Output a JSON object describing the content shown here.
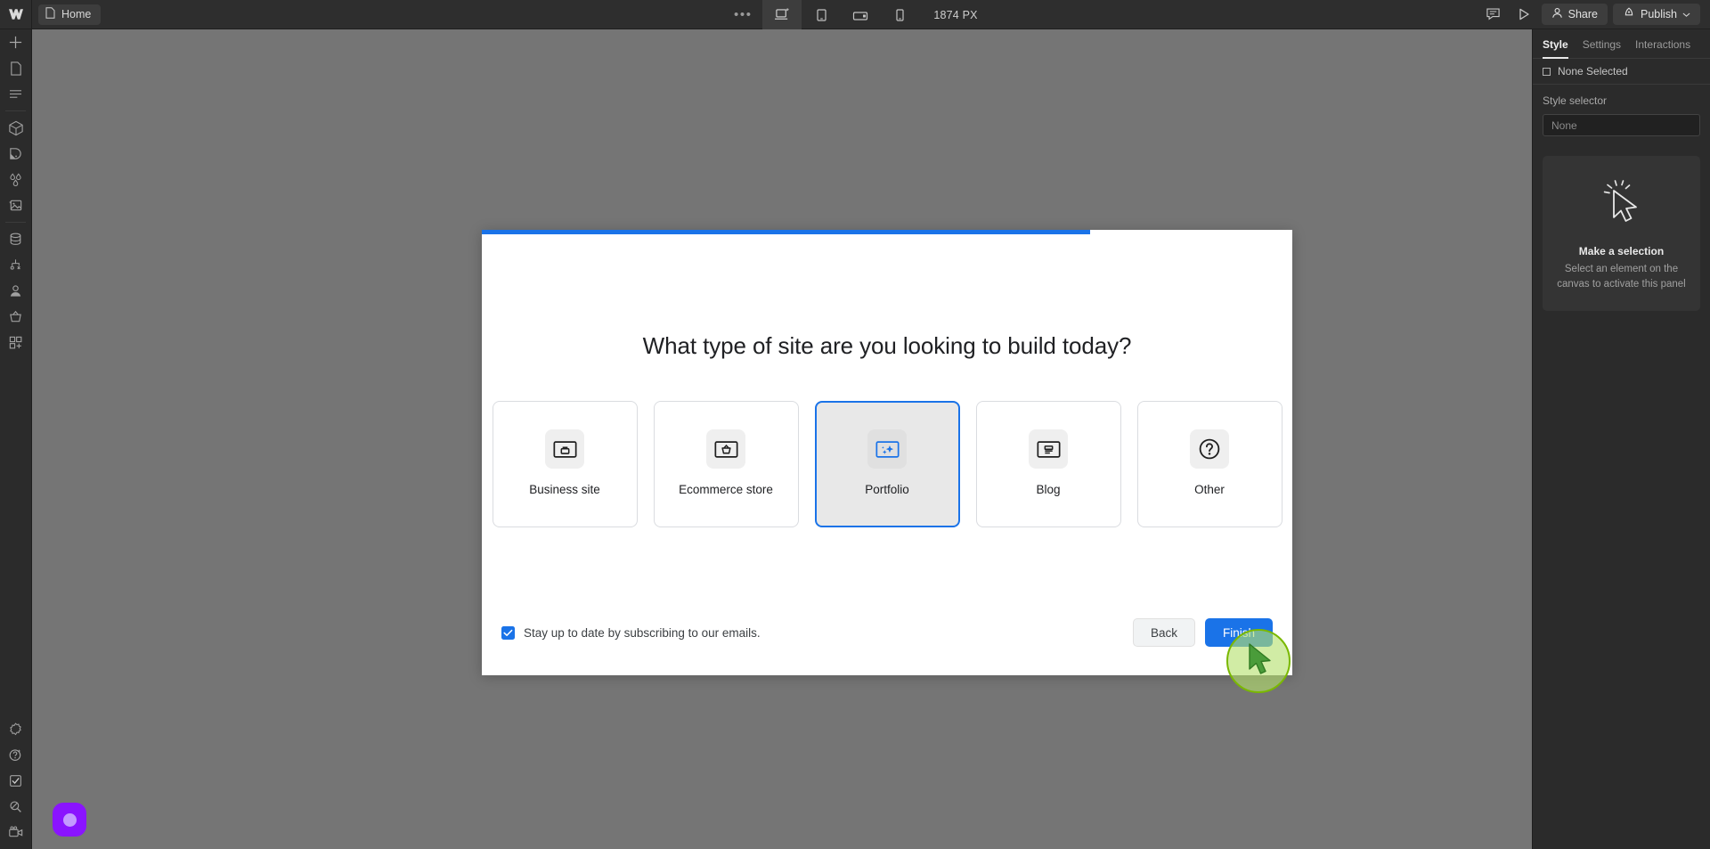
{
  "topbar": {
    "logo_icon": "webflow-logo-icon",
    "page_chip": {
      "icon": "page-icon",
      "label": "Home"
    },
    "more_icon": "ellipsis-icon",
    "devices": [
      {
        "name": "desktop",
        "icon": "desktop-breakpoint-icon",
        "active": true
      },
      {
        "name": "tablet",
        "icon": "tablet-icon",
        "active": false
      },
      {
        "name": "mobile-landscape",
        "icon": "mobile-landscape-icon",
        "active": false
      },
      {
        "name": "mobile-portrait",
        "icon": "mobile-portrait-icon",
        "active": false
      }
    ],
    "viewport_size": "1874 PX",
    "comment_icon": "comment-icon",
    "preview_icon": "play-preview-icon",
    "share": {
      "icon": "person-icon",
      "label": "Share"
    },
    "publish": {
      "icon": "rocket-icon",
      "label": "Publish",
      "caret": "chevron-down-icon"
    }
  },
  "sidebar": {
    "items": [
      {
        "name": "add-elements",
        "icon": "plus-icon"
      },
      {
        "name": "pages",
        "icon": "page-icon"
      },
      {
        "name": "navigator",
        "icon": "layers-icon"
      },
      {
        "name": "components",
        "icon": "cube-icon"
      },
      {
        "name": "assets-variables",
        "icon": "swatch-icon"
      },
      {
        "name": "variables",
        "icon": "droplets-icon"
      },
      {
        "name": "assets",
        "icon": "image-icon"
      },
      {
        "name": "cms",
        "icon": "database-icon"
      },
      {
        "name": "logic",
        "icon": "logic-flow-icon"
      },
      {
        "name": "users",
        "icon": "person-icon"
      },
      {
        "name": "ecommerce",
        "icon": "basket-icon"
      },
      {
        "name": "apps",
        "icon": "apps-grid-icon"
      }
    ],
    "bottom_items": [
      {
        "name": "settings",
        "icon": "gear-icon"
      },
      {
        "name": "ai-assist",
        "icon": "question-sparkle-icon"
      },
      {
        "name": "audit",
        "icon": "checkbox-icon"
      },
      {
        "name": "search",
        "icon": "search-icon"
      },
      {
        "name": "video",
        "icon": "video-camera-icon"
      }
    ],
    "helper_bubble": "assistant-bubble-icon"
  },
  "modal": {
    "progress_percent": 75,
    "progress_color": "#1a73e8",
    "title": "What type of site are you looking to build today?",
    "options": [
      {
        "label": "Business site",
        "icon": "briefcase-window-icon",
        "selected": false
      },
      {
        "label": "Ecommerce store",
        "icon": "basket-window-icon",
        "selected": false
      },
      {
        "label": "Portfolio",
        "icon": "sparkle-window-icon",
        "selected": true
      },
      {
        "label": "Blog",
        "icon": "article-window-icon",
        "selected": false
      },
      {
        "label": "Other",
        "icon": "question-circle-icon",
        "selected": false
      }
    ],
    "subscribe": {
      "checked": true,
      "label": "Stay up to date by subscribing to our emails."
    },
    "back_label": "Back",
    "finish_label": "Finish"
  },
  "cursor_highlight": {
    "icon": "cursor-arrow-icon",
    "color": "#7ab800"
  },
  "rightpanel": {
    "tabs": [
      {
        "label": "Style",
        "active": true
      },
      {
        "label": "Settings",
        "active": false
      },
      {
        "label": "Interactions",
        "active": false
      }
    ],
    "selection_text": "None Selected",
    "style_selector_label": "Style selector",
    "style_selector_value": "None",
    "empty_state": {
      "icon": "cursor-click-icon",
      "title": "Make a selection",
      "subtitle": "Select an element on the canvas to activate this panel"
    }
  }
}
